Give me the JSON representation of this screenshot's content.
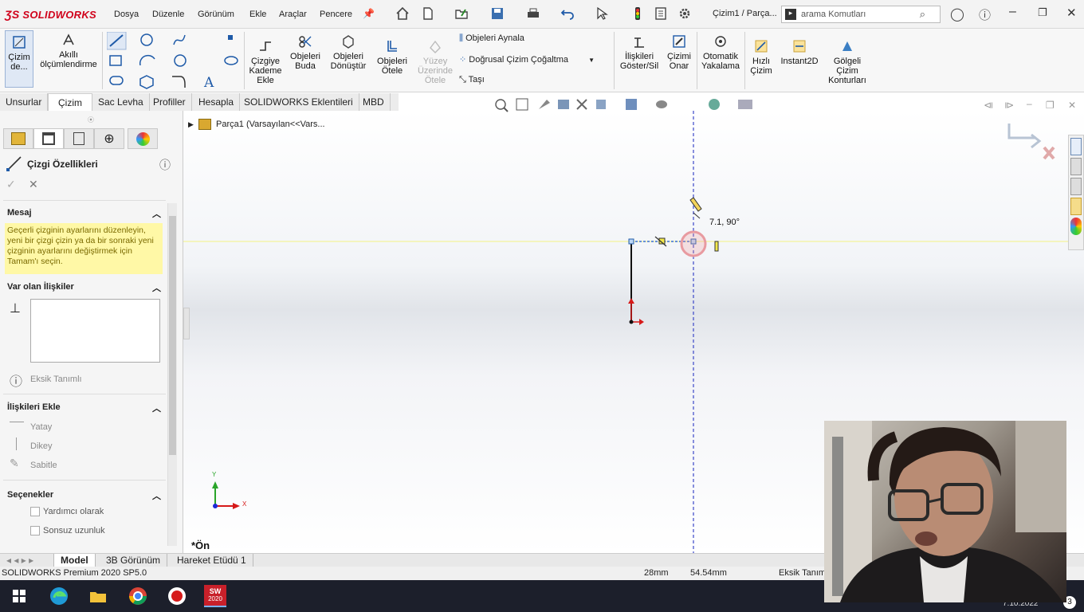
{
  "app": {
    "logo": "SOLIDWORKS",
    "doc_title": "Çizim1 / Parça...",
    "search_placeholder": "arama Komutları"
  },
  "menus": [
    "Dosya",
    "Düzenle",
    "Görünüm",
    "Ekle",
    "Araçlar",
    "Pencere"
  ],
  "ribbon": {
    "sketch": "Çizim de...",
    "smart_dim": "Akıllı ölçümlendirme",
    "offset": "Çizgiye Kademe Ekle",
    "trim": "Objeleri Buda",
    "convert": "Objeleri Dönüştür",
    "offset_entities": "Objeleri Ötele",
    "surface_offset": "Yüzey Üzerinde Ötele",
    "mirror": "Objeleri Aynala",
    "linear_pattern": "Doğrusal Çizim Çoğaltma",
    "move": "Taşı",
    "relations": "İlişkileri Göster/Sil",
    "repair": "Çizimi Onar",
    "quick_snaps": "Otomatik Yakalama",
    "rapid_sketch": "Hızlı Çizim",
    "instant2d": "Instant2D",
    "shaded": "Gölgeli Çizim Konturları"
  },
  "tabs": [
    "Unsurlar",
    "Çizim",
    "Sac Levha",
    "Profiller",
    "Hesapla",
    "SOLIDWORKS Eklentileri",
    "MBD"
  ],
  "active_tab": "Çizim",
  "tree": {
    "part": "Parça1  (Varsayılan<<Vars..."
  },
  "panel": {
    "title": "Çizgi Özellikleri",
    "msg_header": "Mesaj",
    "msg_text": "Geçerli çizginin ayarlarını düzenleyin, yeni bir çizgi çizin ya da bir sonraki yeni çizginin ayarlarını değiştirmek için Tamam'ı seçin.",
    "existing_header": "Var olan İlişkiler",
    "status_text": "Eksik Tanımlı",
    "add_header": "İlişkileri Ekle",
    "rel_horizontal": "Yatay",
    "rel_vertical": "Dikey",
    "rel_fix": "Sabitle",
    "options_header": "Seçenekler",
    "opt_construction": "Yardımcı olarak",
    "opt_infinite": "Sonsuz uzunluk"
  },
  "canvas": {
    "view_label": "*Ön",
    "dim_tip": "7.1, 90°",
    "axis_x": "X",
    "axis_y": "Y"
  },
  "bottom_tabs": [
    "Model",
    "3B Görünüm",
    "Hareket Etüdü 1"
  ],
  "status": {
    "product": "SOLIDWORKS Premium 2020 SP5.0",
    "x": "28mm",
    "y": "54.54mm",
    "state": "Eksik Tanımlı"
  },
  "taskbar": {
    "date": "7.10.2022",
    "sw_badge": "2020",
    "notif": "3"
  },
  "colors": {
    "brand": "#d0021b",
    "accent": "#1e5aa8",
    "msg_bg": "#fff8a6"
  }
}
